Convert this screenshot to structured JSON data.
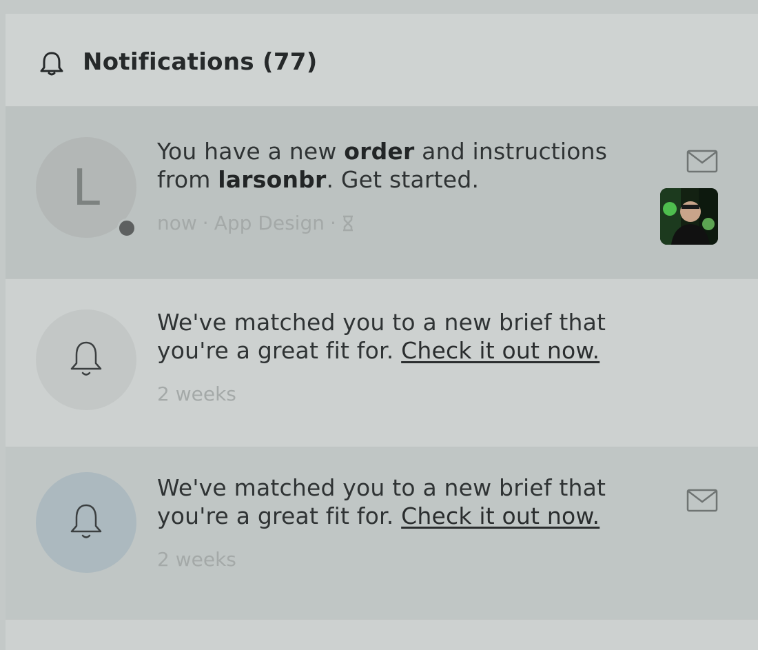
{
  "header": {
    "icon": "bell-icon",
    "title": "Notifications (77)"
  },
  "notifications": [
    {
      "avatar_letter": "L",
      "unread_dot": true,
      "text_parts": {
        "t1": "You have a new ",
        "b1": "order",
        "t2": " and instructions from ",
        "b2": "larsonbr",
        "t3": ". Get started."
      },
      "meta": {
        "time": "now",
        "category": "App Design",
        "status_icon": "hourglass-icon"
      },
      "action_icon": "mail-icon",
      "thumbnail": "user-photo"
    },
    {
      "avatar_icon": "bell-icon",
      "text": "We've matched you to a new brief that you're a great fit for. ",
      "link": "Check it out now.",
      "time": "2 weeks"
    },
    {
      "avatar_icon": "bell-icon",
      "text": "We've matched you to a new brief that you're a great fit for. ",
      "link": "Check it out now.",
      "time": "2 weeks",
      "action_icon": "mail-icon"
    }
  ],
  "meta_separator": "·",
  "colors": {
    "panel": "#cdd1d0",
    "unread_row": "#bcc2c1",
    "avatar_blue": "#acb9bf",
    "text": "#2f3334",
    "muted": "#a4a9a8"
  }
}
